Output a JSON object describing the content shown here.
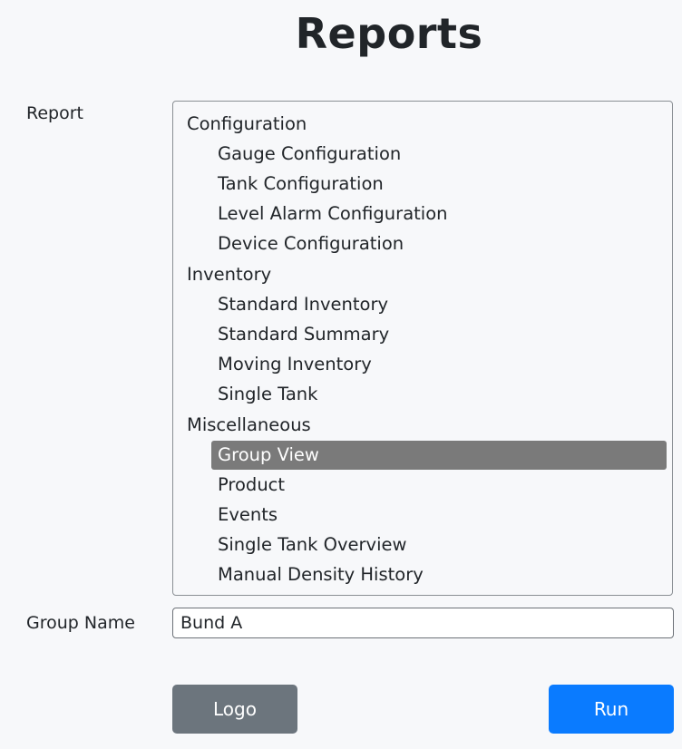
{
  "page": {
    "title": "Reports"
  },
  "form": {
    "report_label": "Report",
    "group_name_label": "Group Name",
    "group_name_value": "Bund A"
  },
  "report_list": {
    "groups": [
      {
        "label": "Configuration",
        "options": [
          "Gauge Configuration",
          "Tank Configuration",
          "Level Alarm Configuration",
          "Device Configuration"
        ]
      },
      {
        "label": "Inventory",
        "options": [
          "Standard Inventory",
          "Standard Summary",
          "Moving Inventory",
          "Single Tank"
        ]
      },
      {
        "label": "Miscellaneous",
        "options": [
          "Group View",
          "Product",
          "Events",
          "Single Tank Overview",
          "Manual Density History"
        ]
      }
    ],
    "selected": "Group View"
  },
  "buttons": {
    "logo_label": "Logo",
    "run_label": "Run"
  },
  "colors": {
    "run_button": "#0a7bff",
    "logo_button": "#6c757d",
    "selected_option": "#7a7a7a"
  }
}
